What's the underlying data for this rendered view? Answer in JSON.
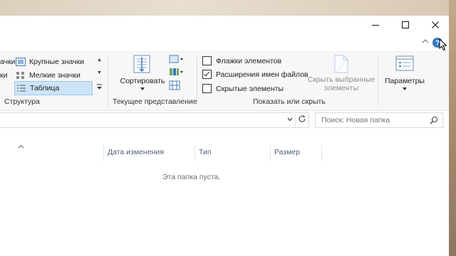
{
  "ribbon": {
    "layout": {
      "items": [
        {
          "label": "ачки"
        },
        {
          "label": "ки"
        },
        {
          "label": "Крупные значки"
        },
        {
          "label": "Мелкие значки"
        },
        {
          "label": "Таблица"
        }
      ],
      "group_label": "Структура"
    },
    "current_view": {
      "sort_label": "Сортировать",
      "group_label": "Текущее представление"
    },
    "show_hide": {
      "checkboxes": [
        {
          "label": "Флажки элементов",
          "checked": false
        },
        {
          "label": "Расширения имен файлов",
          "checked": true
        },
        {
          "label": "Скрытые элементы",
          "checked": false
        }
      ],
      "hide_selected_line1": "Скрыть выбранные",
      "hide_selected_line2": "элементы",
      "group_label": "Показать или скрыть"
    },
    "options_label": "Параметры"
  },
  "search": {
    "placeholder": "Поиск: Новая папка"
  },
  "columns": [
    "Дата изменения",
    "Тип",
    "Размер"
  ],
  "empty_message": "Эта папка пуста.",
  "colors": {
    "accent": "#cce4f7",
    "icon_blue": "#2b79d0"
  }
}
